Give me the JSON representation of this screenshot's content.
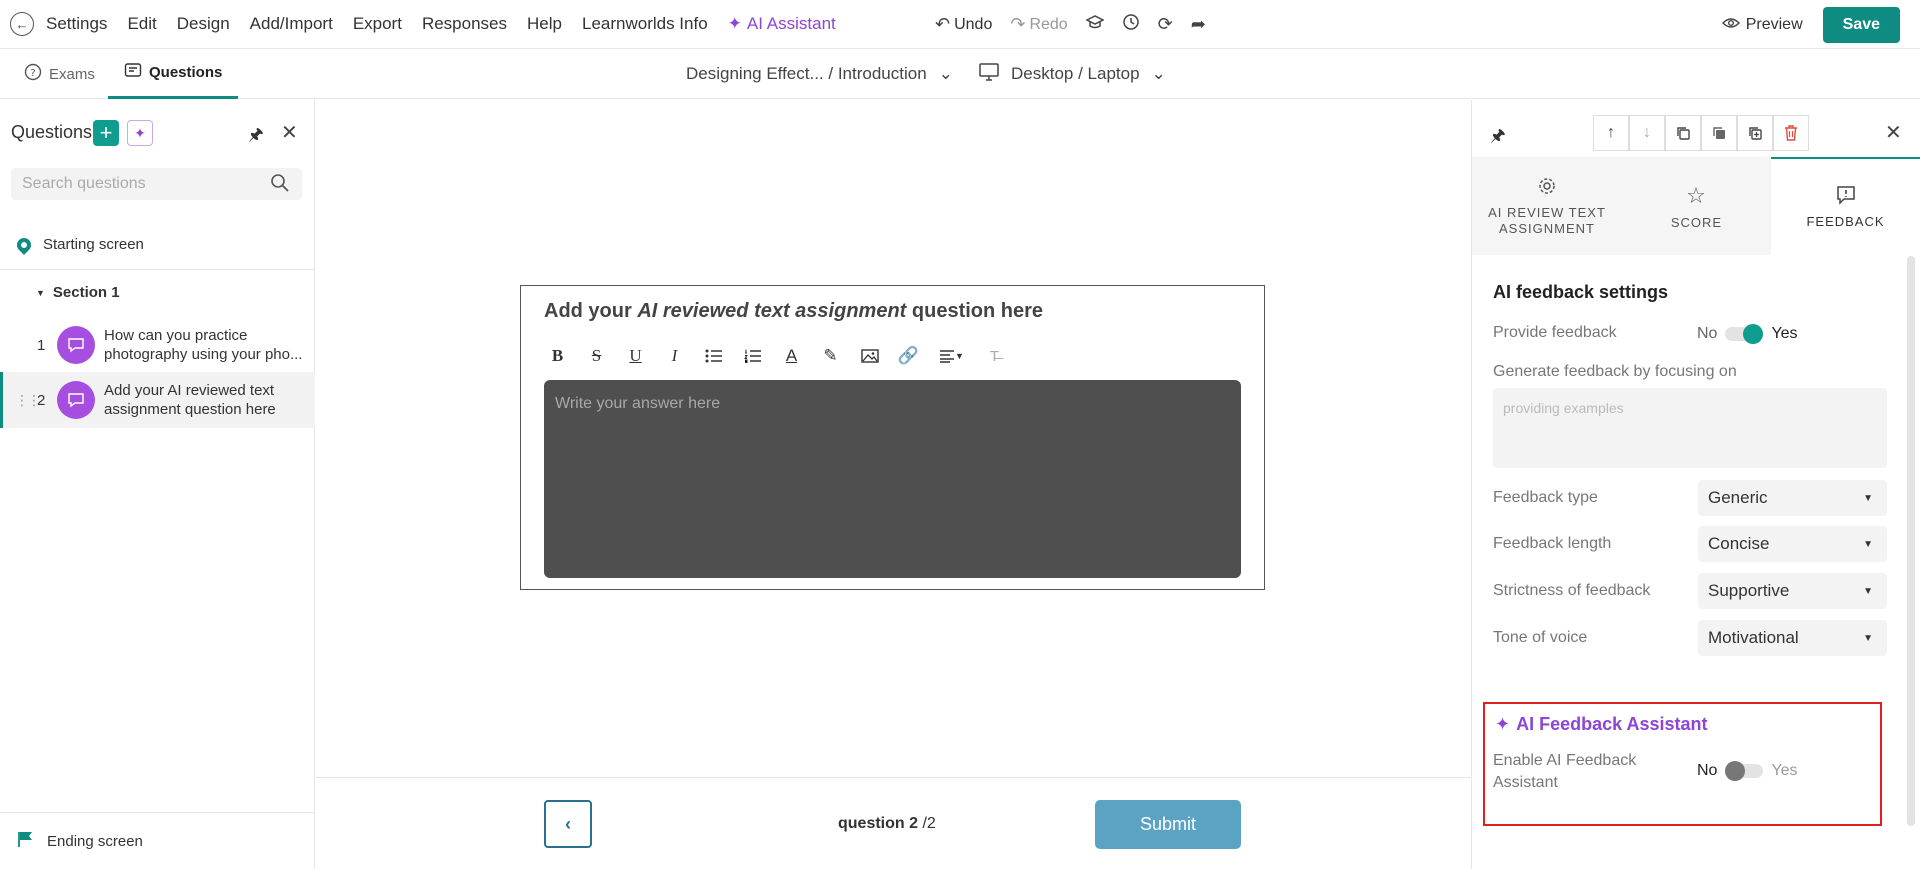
{
  "menu": {
    "items": [
      "Settings",
      "Edit",
      "Design",
      "Add/Import",
      "Export",
      "Responses",
      "Help",
      "Learnworlds Info"
    ],
    "ai_assistant": "AI Assistant"
  },
  "tools": {
    "undo": "Undo",
    "redo": "Redo"
  },
  "header_right": {
    "preview": "Preview",
    "save": "Save"
  },
  "tabs": {
    "exams": "Exams",
    "questions": "Questions"
  },
  "breadcrumb": "Designing Effect... / Introduction",
  "device": "Desktop / Laptop",
  "sidebar": {
    "title": "Questions",
    "search_placeholder": "Search questions",
    "starting_screen": "Starting screen",
    "section": "Section 1",
    "questions": [
      {
        "num": "1",
        "text": "How can you practice photography using your pho..."
      },
      {
        "num": "2",
        "text": "Add your AI reviewed text assignment question here"
      }
    ],
    "ending_screen": "Ending screen"
  },
  "canvas": {
    "title_prefix": "Add your ",
    "title_emph": "AI reviewed text assignment",
    "title_suffix": " question here",
    "answer_placeholder": "Write your answer here",
    "count_current": "question 2",
    "count_total": "/2",
    "submit": "Submit"
  },
  "right_panel": {
    "tabs": {
      "ai_review": "AI REVIEW TEXT ASSIGNMENT",
      "score": "SCORE",
      "feedback": "FEEDBACK"
    },
    "settings_title": "AI feedback settings",
    "provide_feedback": {
      "label": "Provide feedback",
      "no": "No",
      "yes": "Yes",
      "value": "yes"
    },
    "focus_label": "Generate feedback by focusing on",
    "focus_placeholder": "providing examples",
    "feedback_type": {
      "label": "Feedback type",
      "value": "Generic"
    },
    "feedback_length": {
      "label": "Feedback length",
      "value": "Concise"
    },
    "strictness": {
      "label": "Strictness of feedback",
      "value": "Supportive"
    },
    "tone": {
      "label": "Tone of voice",
      "value": "Motivational"
    },
    "assistant": {
      "title": "AI Feedback Assistant",
      "label": "Enable AI Feedback Assistant",
      "no": "No",
      "yes": "Yes",
      "value": "no"
    }
  },
  "colors": {
    "brand": "#0f8c82",
    "ai_purple": "#8e44d6",
    "highlight_border": "#e02020",
    "submit": "#5aa3c2"
  }
}
